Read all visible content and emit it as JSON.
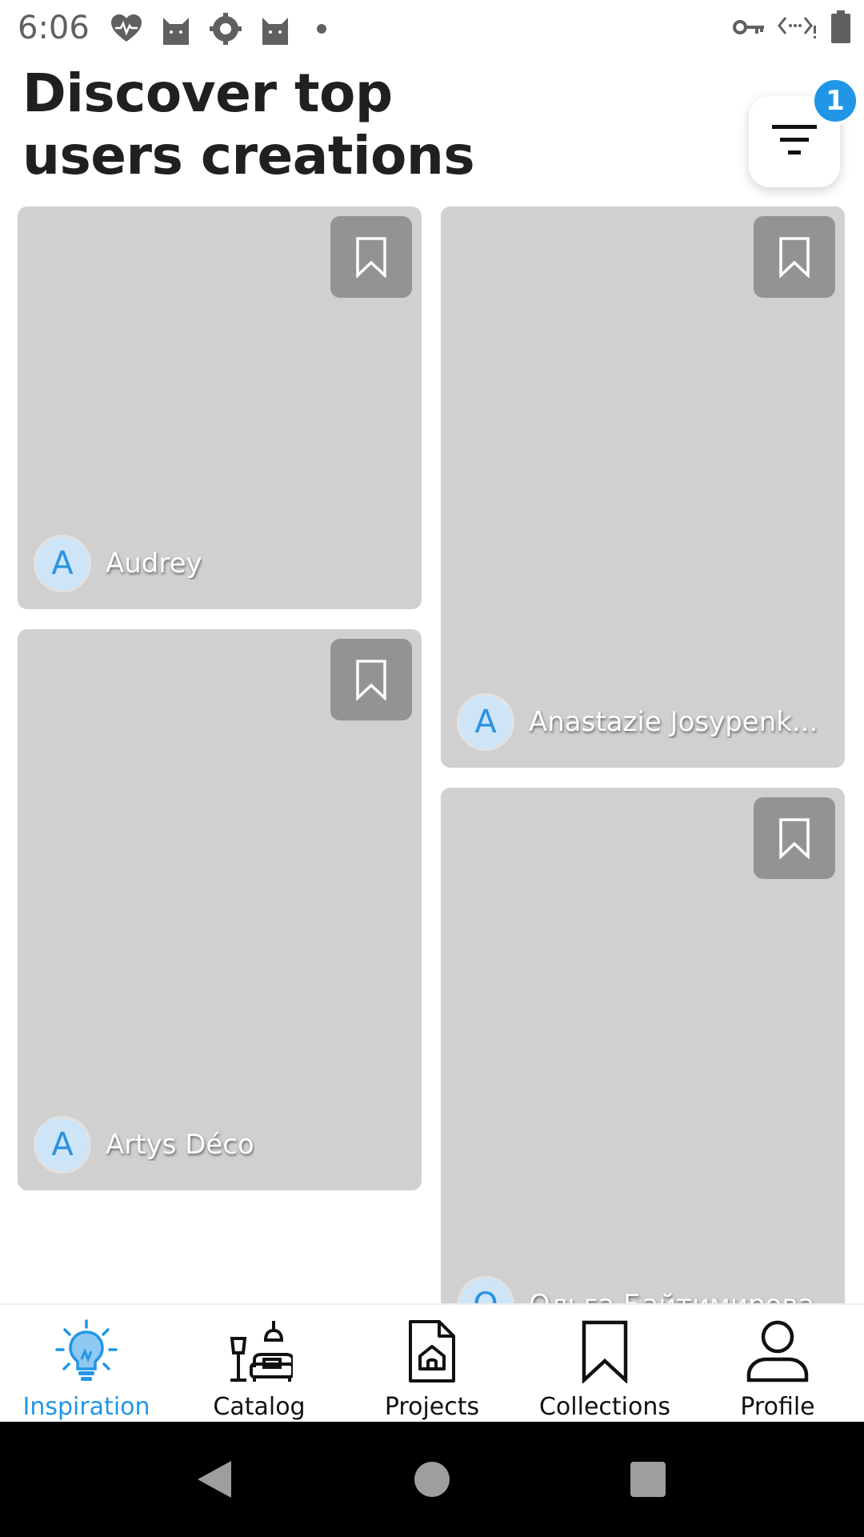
{
  "status_bar": {
    "time": "6:06",
    "left_icons": [
      "heart-pulse-icon",
      "cat-icon",
      "puzzle-icon",
      "cat-icon"
    ],
    "right_icons": [
      "vpn-key-icon",
      "network-icon",
      "battery-icon"
    ]
  },
  "header": {
    "title": "Discover top users creations",
    "filter_badge_count": "1"
  },
  "cards": [
    {
      "author_initial": "A",
      "author_name": "Audrey"
    },
    {
      "author_initial": "A",
      "author_name": "Anastazie Josypenk..."
    },
    {
      "author_initial": "A",
      "author_name": "Artys Déco"
    },
    {
      "author_initial": "О",
      "author_name": "Ольга Байтимирова"
    }
  ],
  "bottom_nav": {
    "items": [
      {
        "label": "Inspiration",
        "icon": "lightbulb-icon",
        "active": true
      },
      {
        "label": "Catalog",
        "icon": "furniture-icon",
        "active": false
      },
      {
        "label": "Projects",
        "icon": "project-file-icon",
        "active": false
      },
      {
        "label": "Collections",
        "icon": "bookmark-icon",
        "active": false
      },
      {
        "label": "Profile",
        "icon": "person-icon",
        "active": false
      }
    ]
  },
  "colors": {
    "accent": "#2196E6",
    "card_placeholder": "#d0d0d0",
    "bookmark_bg": "#939393"
  }
}
